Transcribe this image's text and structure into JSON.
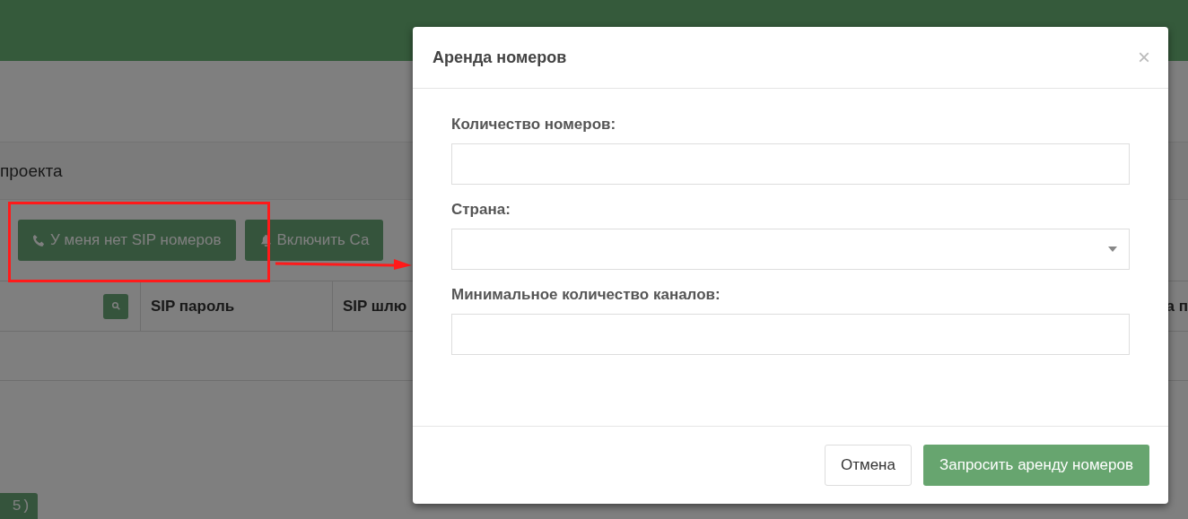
{
  "page": {
    "project_label": "проекта",
    "buttons": [
      {
        "kind": "phone",
        "label": "У меня нет SIP номеров"
      },
      {
        "kind": "bell",
        "label": "Включить Са"
      }
    ],
    "table": {
      "columns": [
        "SIP пароль",
        "SIP шлю",
        "а п"
      ]
    },
    "bottom_button": "5)"
  },
  "modal": {
    "title": "Аренда номеров",
    "close": "×",
    "fields": [
      {
        "kind": "text",
        "label": "Количество номеров:"
      },
      {
        "kind": "select",
        "label": "Страна:"
      },
      {
        "kind": "text",
        "label": "Минимальное количество каналов:"
      }
    ],
    "buttons": [
      {
        "kind": "default",
        "label": "Отмена"
      },
      {
        "kind": "primary",
        "label": "Запросить аренду номеров"
      }
    ]
  }
}
